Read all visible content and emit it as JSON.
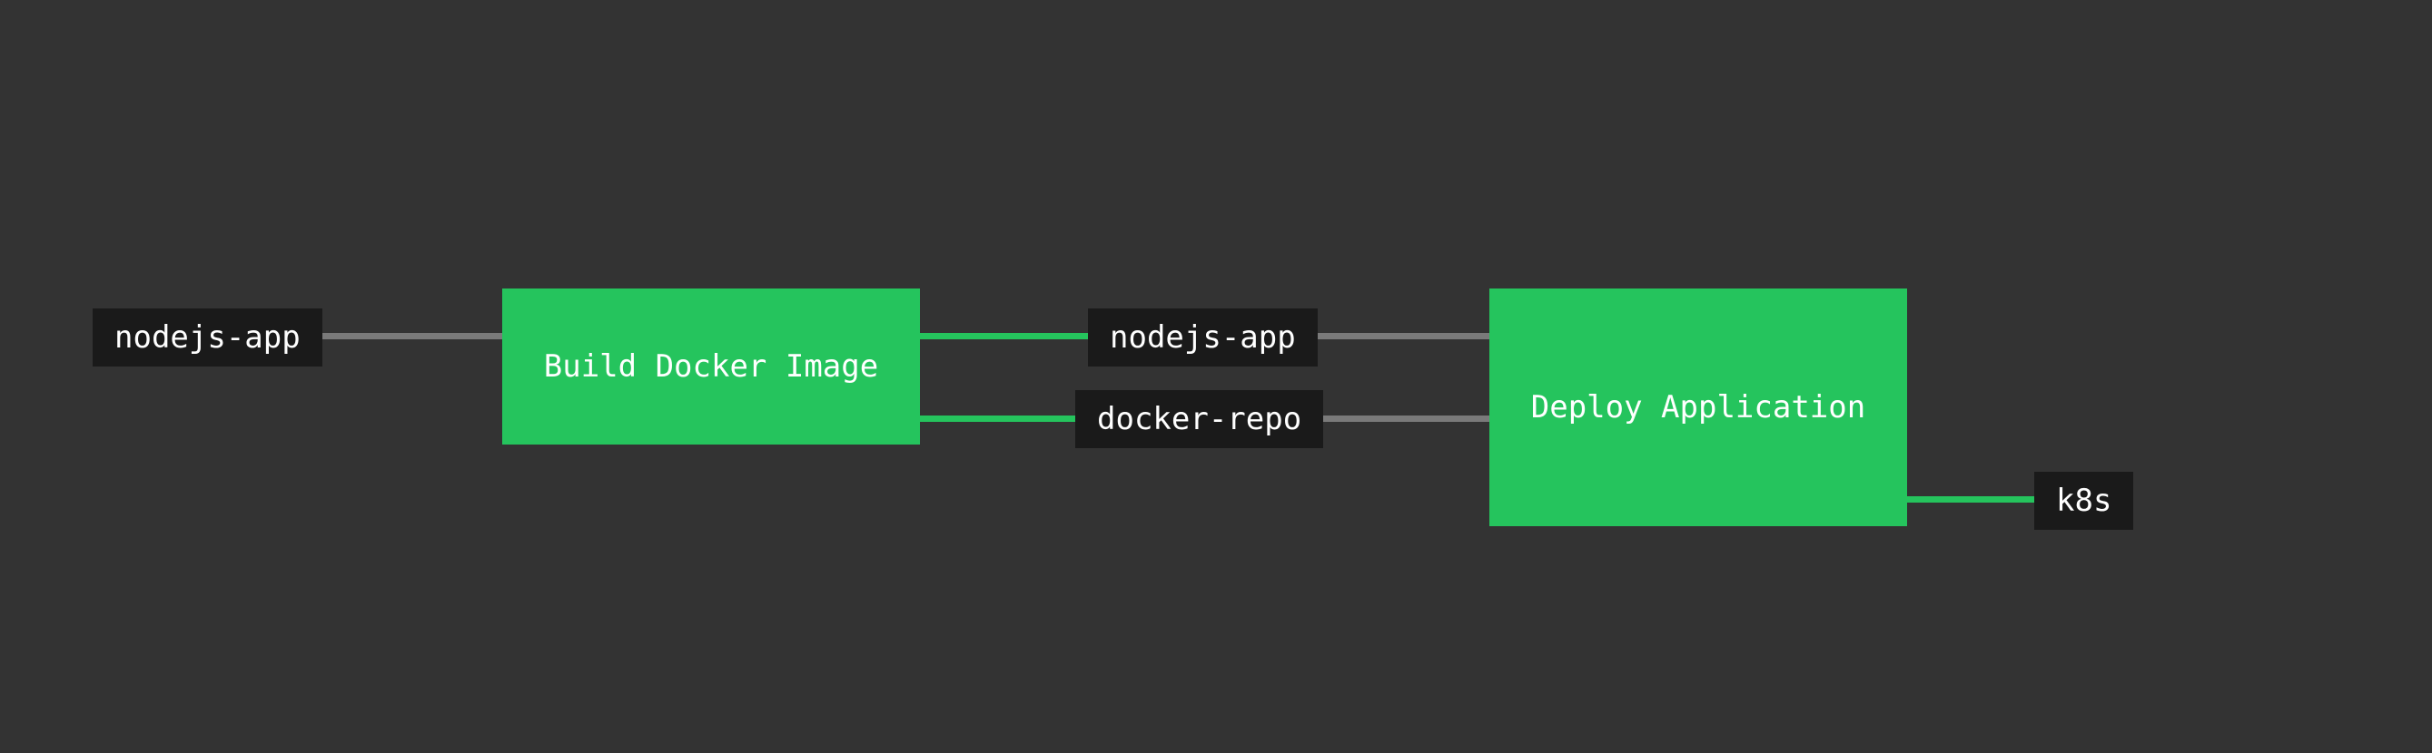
{
  "stages": {
    "build": {
      "label": "Build Docker Image"
    },
    "deploy": {
      "label": "Deploy Application"
    }
  },
  "artifacts": {
    "input_app": {
      "label": "nodejs-app"
    },
    "built_app": {
      "label": "nodejs-app"
    },
    "docker_repo": {
      "label": "docker-repo"
    },
    "k8s": {
      "label": "k8s"
    }
  },
  "colors": {
    "stage_bg": "#25c45d",
    "artifact_bg": "#1a1a1a",
    "connector_input": "#7a7a7a",
    "connector_output": "#25c45d",
    "canvas_bg": "#333333"
  }
}
